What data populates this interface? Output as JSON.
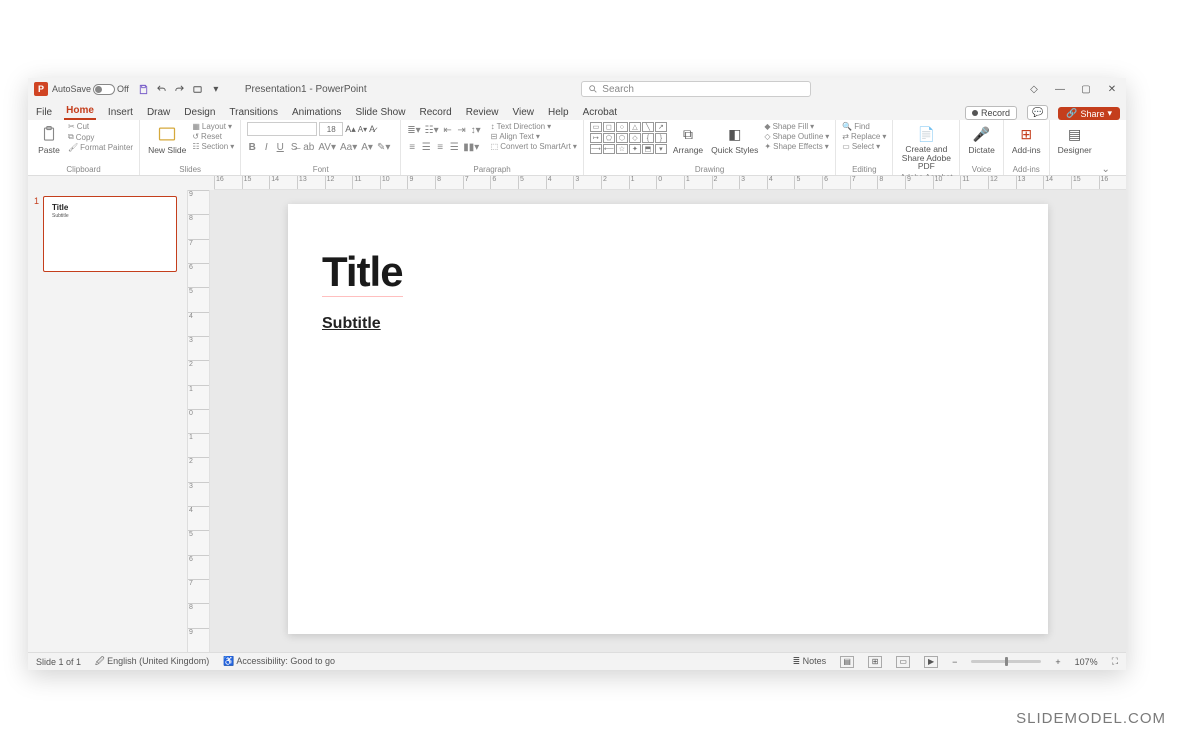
{
  "titlebar": {
    "autosave_label": "AutoSave",
    "autosave_state": "Off",
    "doc_title": "Presentation1 - PowerPoint",
    "search_placeholder": "Search"
  },
  "tabs": {
    "items": [
      "File",
      "Home",
      "Insert",
      "Draw",
      "Design",
      "Transitions",
      "Animations",
      "Slide Show",
      "Record",
      "Review",
      "View",
      "Help",
      "Acrobat"
    ],
    "active": "Home",
    "record": "Record",
    "share": "Share"
  },
  "ribbon": {
    "clipboard": {
      "paste": "Paste",
      "cut": "Cut",
      "copy": "Copy",
      "format_painter": "Format Painter",
      "label": "Clipboard"
    },
    "slides": {
      "new_slide": "New Slide",
      "layout": "Layout",
      "reset": "Reset",
      "section": "Section",
      "label": "Slides"
    },
    "font": {
      "size": "18",
      "label": "Font"
    },
    "paragraph": {
      "text_direction": "Text Direction",
      "align_text": "Align Text",
      "convert_smartart": "Convert to SmartArt",
      "label": "Paragraph"
    },
    "drawing": {
      "arrange": "Arrange",
      "quick_styles": "Quick Styles",
      "shape_fill": "Shape Fill",
      "shape_outline": "Shape Outline",
      "shape_effects": "Shape Effects",
      "label": "Drawing"
    },
    "editing": {
      "find": "Find",
      "replace": "Replace",
      "select": "Select",
      "label": "Editing"
    },
    "adobe": {
      "create": "Create and Share Adobe PDF",
      "label": "Adobe Acrobat"
    },
    "voice": {
      "dictate": "Dictate",
      "label": "Voice"
    },
    "addins": {
      "addins": "Add-ins",
      "label": "Add-ins"
    },
    "designer": {
      "designer": "Designer"
    }
  },
  "thumb": {
    "number": "1",
    "title": "Title",
    "subtitle": "Subtitle"
  },
  "slide": {
    "title": "Title",
    "subtitle": "Subtitle"
  },
  "status": {
    "slide": "Slide 1 of 1",
    "lang": "English (United Kingdom)",
    "accessibility": "Accessibility: Good to go",
    "notes": "Notes",
    "zoom": "107%"
  },
  "watermark": "SLIDEMODEL.COM"
}
